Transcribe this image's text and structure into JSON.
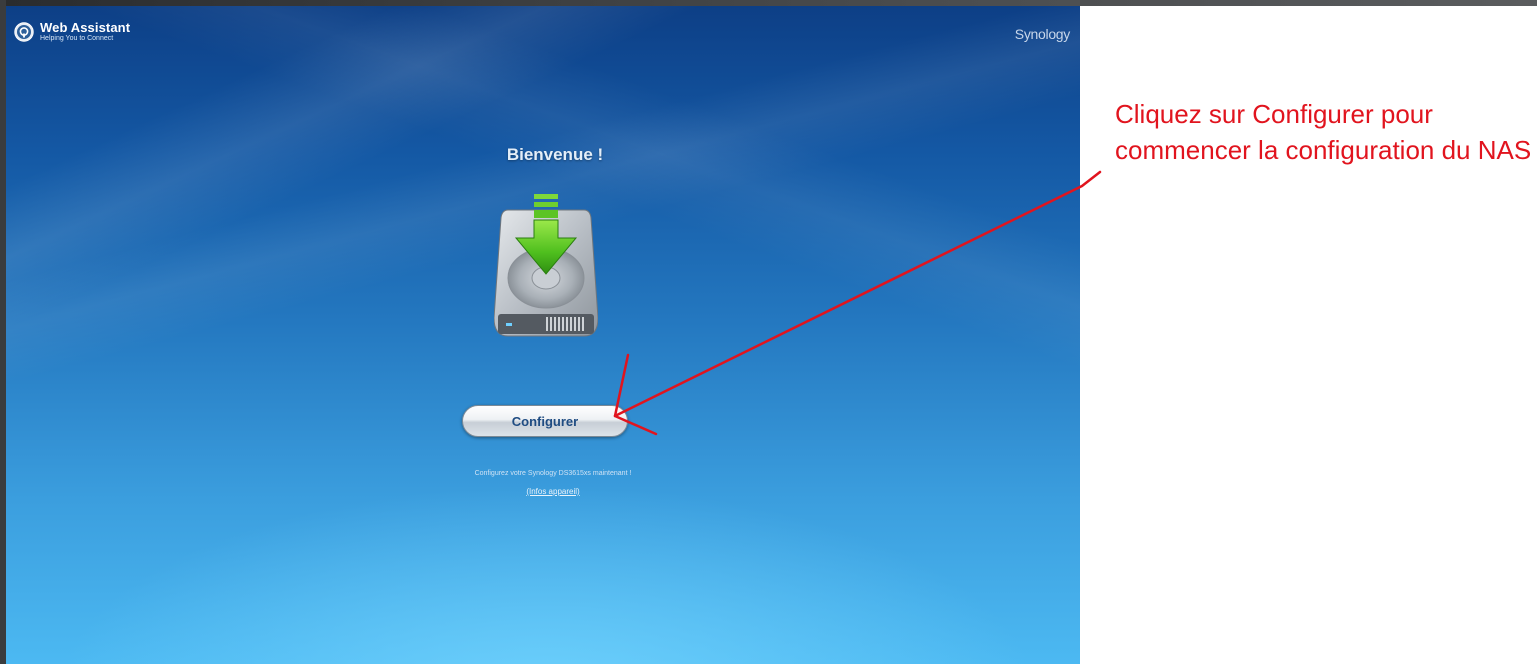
{
  "app": {
    "title": "Web Assistant",
    "subtitle": "Helping You to Connect",
    "brand": "Synology"
  },
  "main": {
    "welcome": "Bienvenue !",
    "configure_button": "Configurer",
    "info_text": "Configurez votre Synology DS3615xs maintenant !",
    "info_link": "(Infos appareil)"
  },
  "annotation": {
    "text": "Cliquez sur Configurer pour commencer la configuration du NAS",
    "color": "#e1141e"
  },
  "icons": [
    "web-assistant-logo-icon",
    "hard-drive-download-icon",
    "red-arrow-annotation"
  ],
  "colors": {
    "screen_top": "#0d3f86",
    "screen_bottom": "#4cb9f2",
    "button_text": "#1f4c82"
  }
}
